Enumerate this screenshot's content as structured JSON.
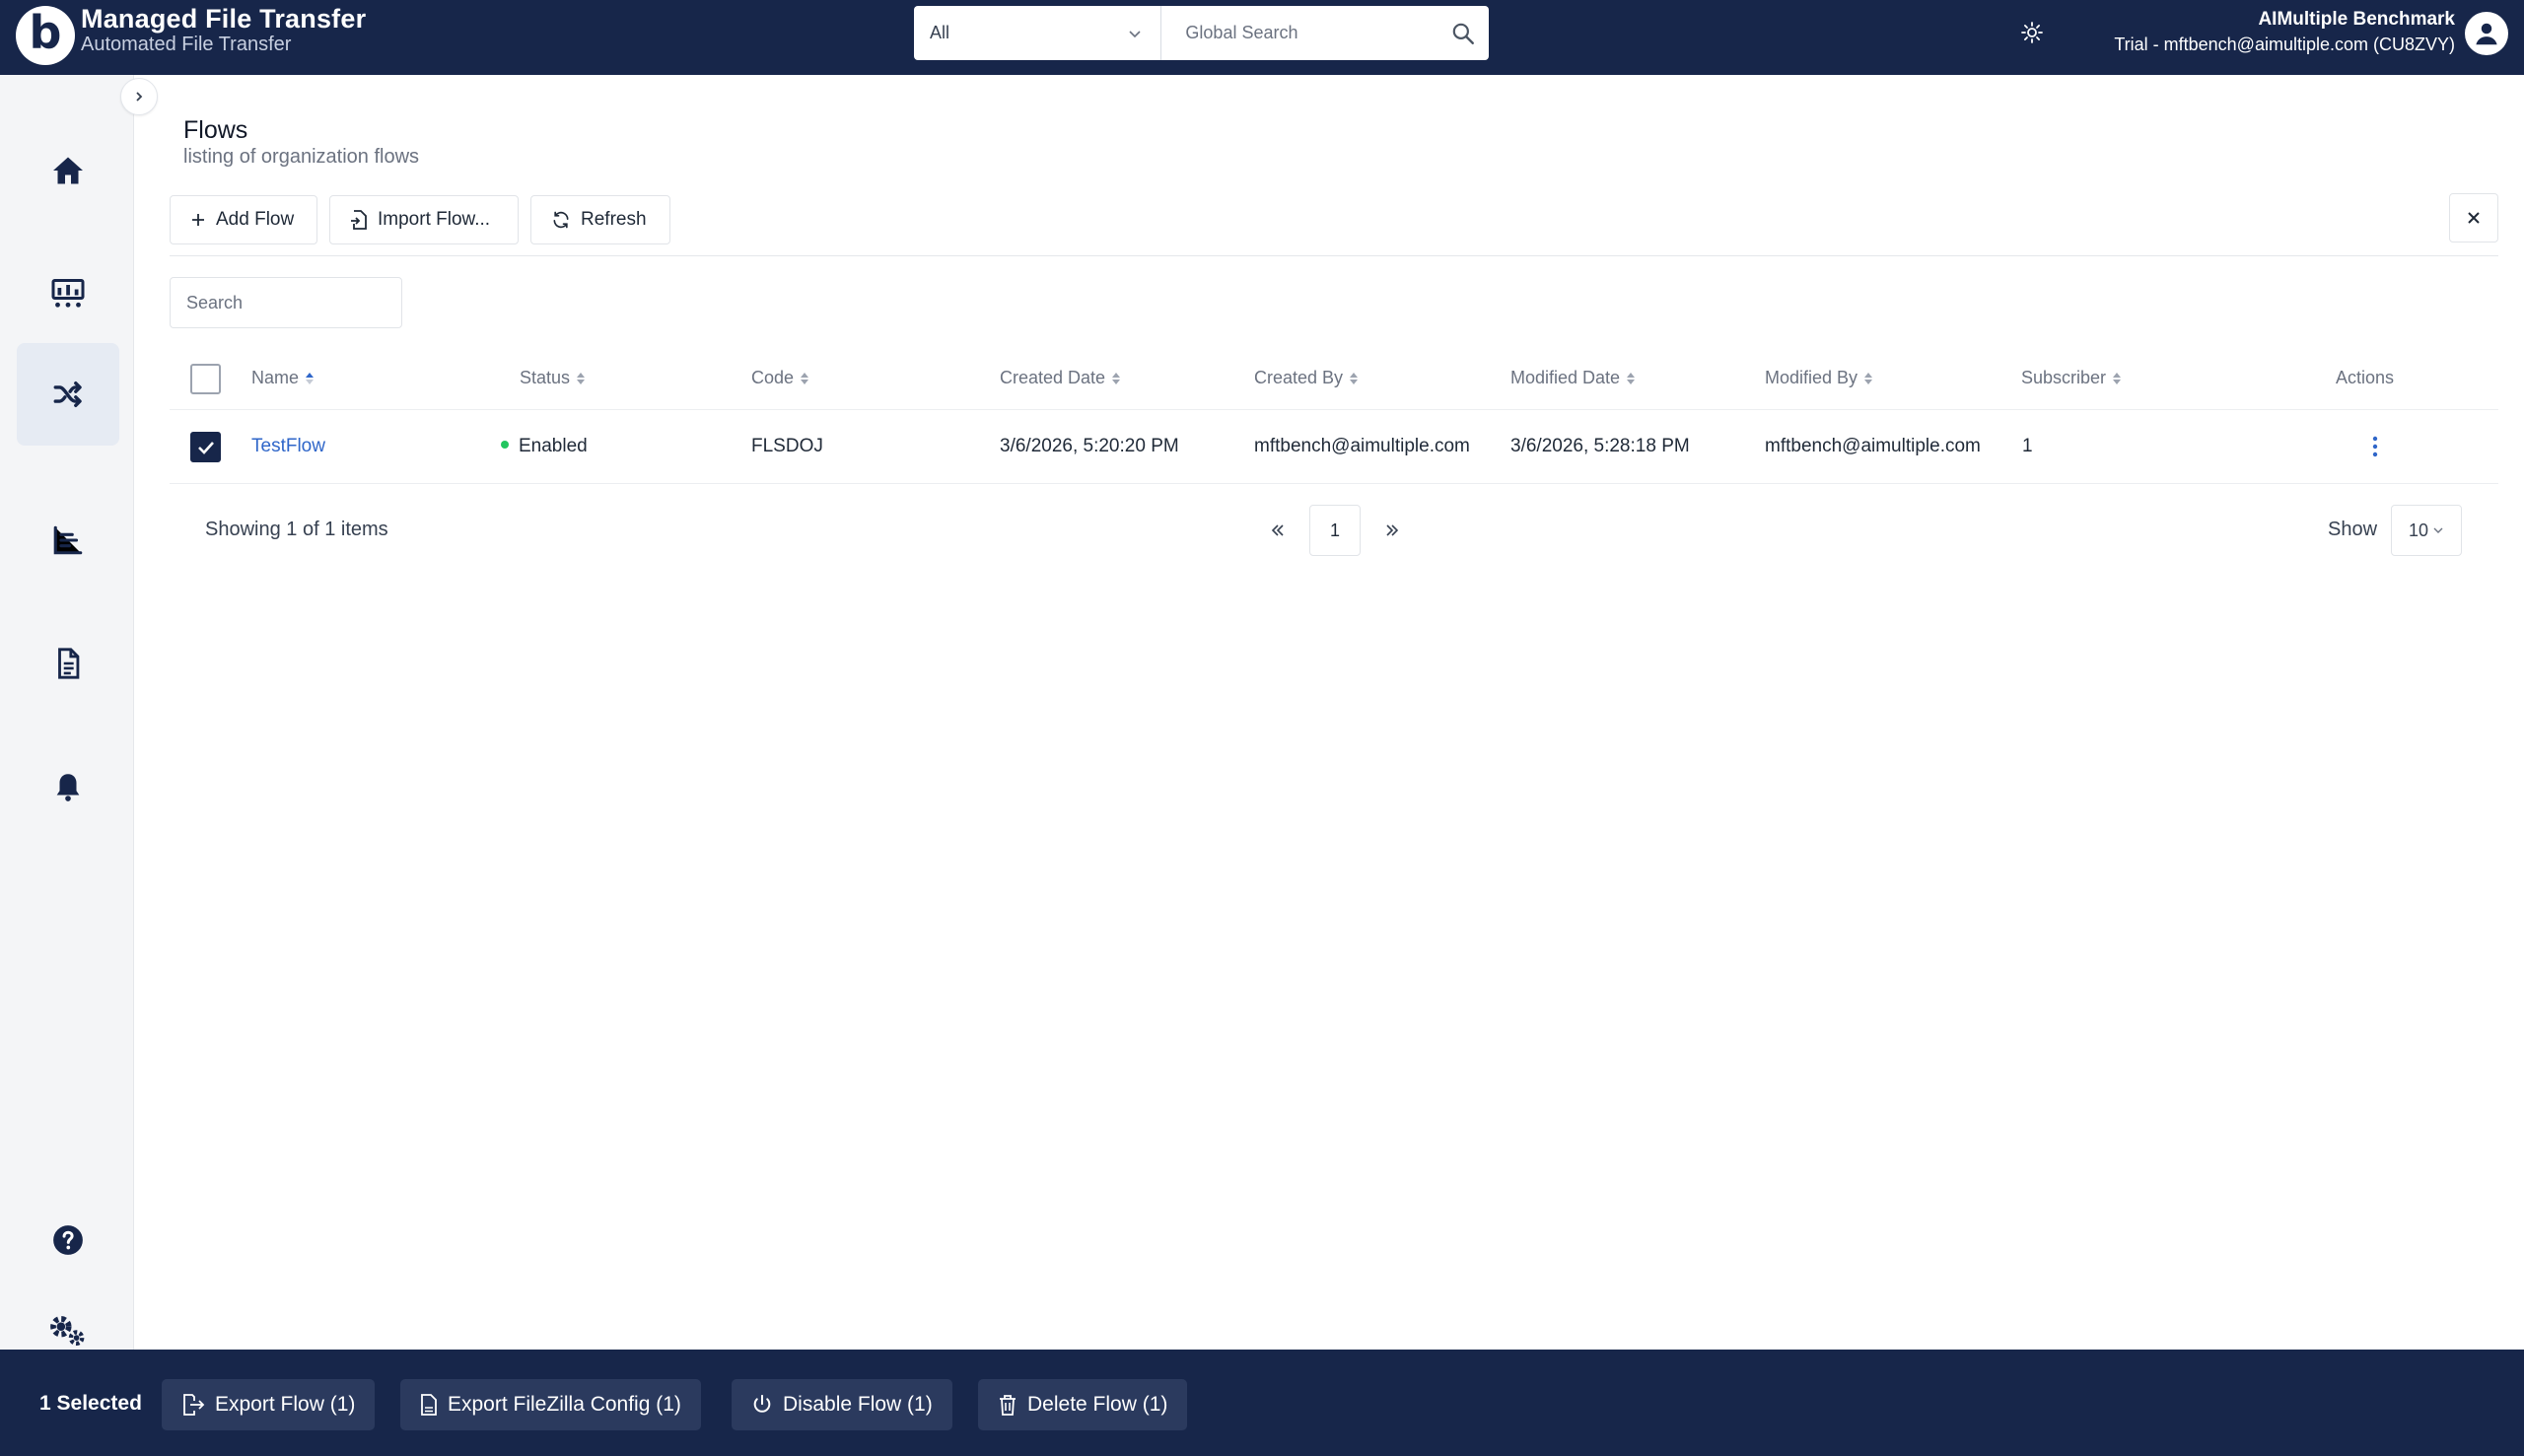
{
  "header": {
    "logo_letter": "b",
    "app_title": "Managed File Transfer",
    "app_subtitle": "Automated File Transfer",
    "search_scope": "All",
    "search_placeholder": "Global Search",
    "org_name": "AIMultiple Benchmark",
    "user_line": "Trial - mftbench@aimultiple.com (CU8ZVY)"
  },
  "sidebar": {
    "items": [
      {
        "icon": "home-icon",
        "active": false
      },
      {
        "icon": "dashboard-icon",
        "active": false
      },
      {
        "icon": "shuffle-icon",
        "active": true
      },
      {
        "icon": "reports-icon",
        "active": false
      },
      {
        "icon": "document-icon",
        "active": false
      },
      {
        "icon": "bell-icon",
        "active": false
      },
      {
        "icon": "help-icon",
        "active": false
      },
      {
        "icon": "settings-icon",
        "active": false
      }
    ]
  },
  "page": {
    "title": "Flows",
    "subtitle": "listing of organization flows"
  },
  "toolbar": {
    "add_label": "Add Flow",
    "import_label": "Import Flow...",
    "refresh_label": "Refresh"
  },
  "table": {
    "search_placeholder": "Search",
    "columns": [
      "Name",
      "Status",
      "Code",
      "Created Date",
      "Created By",
      "Modified Date",
      "Modified By",
      "Subscriber",
      "Actions"
    ],
    "rows": [
      {
        "selected": true,
        "name": "TestFlow",
        "status": "Enabled",
        "code": "FLSDOJ",
        "created_date": "3/6/2026, 5:20:20 PM",
        "created_by": "mftbench@aimultiple.com",
        "modified_date": "3/6/2026, 5:28:18 PM",
        "modified_by": "mftbench@aimultiple.com",
        "subscriber": "1"
      }
    ]
  },
  "pagination": {
    "showing": "Showing 1 of 1 items",
    "current_page": "1",
    "show_label": "Show",
    "page_size": "10"
  },
  "bulk_bar": {
    "selected": "1 Selected",
    "export_flow": "Export Flow (1)",
    "export_filezilla": "Export FileZilla Config (1)",
    "disable_flow": "Disable Flow (1)",
    "delete_flow": "Delete Flow (1)"
  },
  "colors": {
    "navy": "#17264a",
    "link": "#2f66c9",
    "enabled": "#22c55e"
  }
}
